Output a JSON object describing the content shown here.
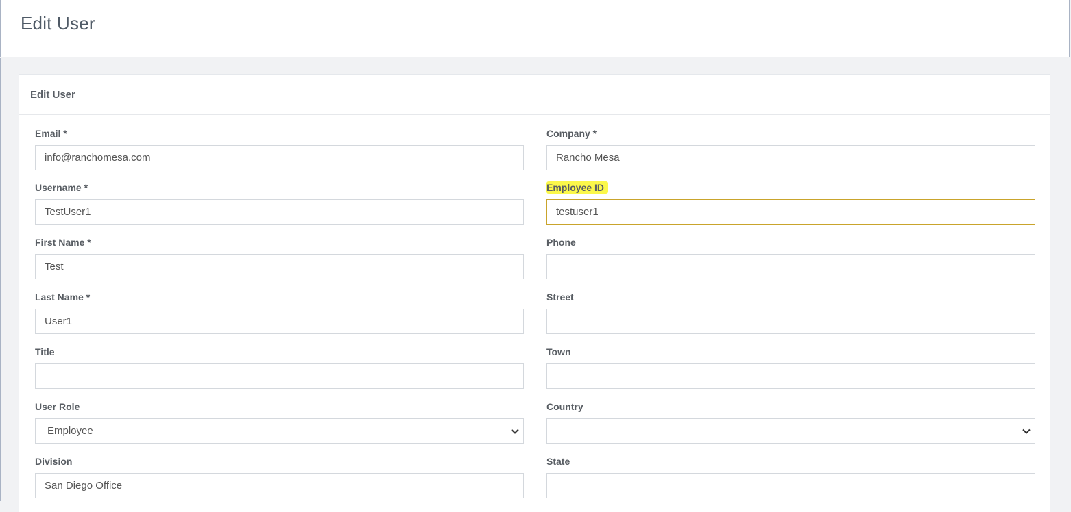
{
  "header": {
    "title": "Edit User"
  },
  "card": {
    "title": "Edit User"
  },
  "form": {
    "left": [
      {
        "label": "Email *",
        "value": "info@ranchomesa.com",
        "type": "text"
      },
      {
        "label": "Username *",
        "value": "TestUser1",
        "type": "text"
      },
      {
        "label": "First Name *",
        "value": "Test",
        "type": "text"
      },
      {
        "label": "Last Name *",
        "value": "User1",
        "type": "text"
      },
      {
        "label": "Title",
        "value": "",
        "type": "text"
      },
      {
        "label": "User Role",
        "value": "Employee",
        "type": "select"
      },
      {
        "label": "Division",
        "value": "San Diego Office",
        "type": "text"
      }
    ],
    "right": [
      {
        "label": "Company *",
        "value": "Rancho Mesa",
        "type": "text"
      },
      {
        "label": "Employee ID",
        "value": "testuser1",
        "type": "text",
        "highlighted": true,
        "focused": true
      },
      {
        "label": "Phone",
        "value": "",
        "type": "text"
      },
      {
        "label": "Street",
        "value": "",
        "type": "text"
      },
      {
        "label": "Town",
        "value": "",
        "type": "text"
      },
      {
        "label": "Country",
        "value": "",
        "type": "select"
      },
      {
        "label": "State",
        "value": "",
        "type": "text"
      }
    ]
  },
  "colors": {
    "highlight": "#fbf84a",
    "focus_border": "#c9a42c",
    "input_border": "#d4d8dd",
    "page_background": "#f1f2f4"
  },
  "icons": {
    "select_arrow": "chevron-down-icon"
  }
}
